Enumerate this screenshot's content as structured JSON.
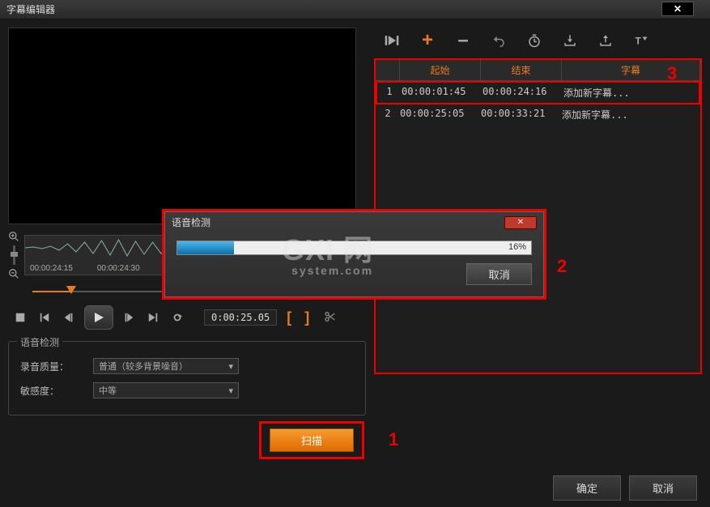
{
  "window": {
    "title": "字幕编辑器"
  },
  "timeline": {
    "timecodes": [
      "00:00:24:15",
      "00:00:24:30"
    ],
    "current_time": "0:00:25.05"
  },
  "voice_detect": {
    "legend": "语音检测",
    "quality_label": "录音质量：",
    "quality_value": "普通（较多背景噪音）",
    "sensitivity_label": "敏感度：",
    "sensitivity_value": "中等",
    "scan_label": "扫描"
  },
  "table": {
    "headers": {
      "start": "起始",
      "end": "结束",
      "subtitle": "字幕"
    },
    "rows": [
      {
        "idx": "1",
        "start": "00:00:01:45",
        "end": "00:00:24:16",
        "sub": "添加新字幕..."
      },
      {
        "idx": "2",
        "start": "00:00:25:05",
        "end": "00:00:33:21",
        "sub": "添加新字幕..."
      }
    ]
  },
  "modal": {
    "title": "语音检测",
    "percent": "16%",
    "cancel": "取消"
  },
  "footer": {
    "ok": "确定",
    "cancel": "取消"
  },
  "annotations": {
    "a1": "1",
    "a2": "2",
    "a3": "3"
  },
  "watermark": {
    "main": "GXI 网",
    "sub": "system.com"
  }
}
